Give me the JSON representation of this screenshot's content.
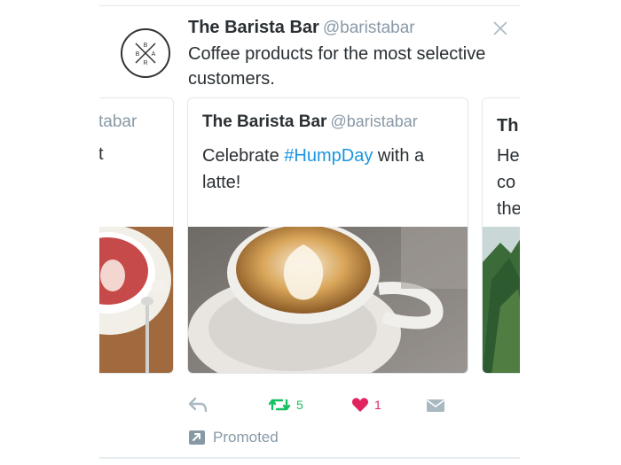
{
  "account": {
    "name": "The Barista Bar",
    "handle": "@baristabar",
    "bio": "Coffee products for the most selective customers.",
    "avatar_letters": [
      "B",
      "B",
      "A",
      "R"
    ]
  },
  "cards": {
    "left": {
      "handle_fragment": "tabar",
      "text_fragment": "t"
    },
    "main": {
      "name": "The Barista Bar",
      "handle": "@baristabar",
      "text_before": "Celebrate ",
      "hashtag": "#HumpDay",
      "text_after": " with a latte!"
    },
    "right": {
      "name_fragment": "Th",
      "lines": [
        "He",
        "co",
        "the"
      ]
    }
  },
  "actions": {
    "retweet_count": "5",
    "like_count": "1"
  },
  "promoted_label": "Promoted",
  "colors": {
    "retweet": "#17bf63",
    "like": "#e0245e",
    "muted_icon": "#aab8c2",
    "hashtag": "#1b95e0"
  },
  "icons": [
    "close-icon",
    "reply-icon",
    "retweet-icon",
    "heart-icon",
    "message-icon",
    "promoted-icon"
  ]
}
